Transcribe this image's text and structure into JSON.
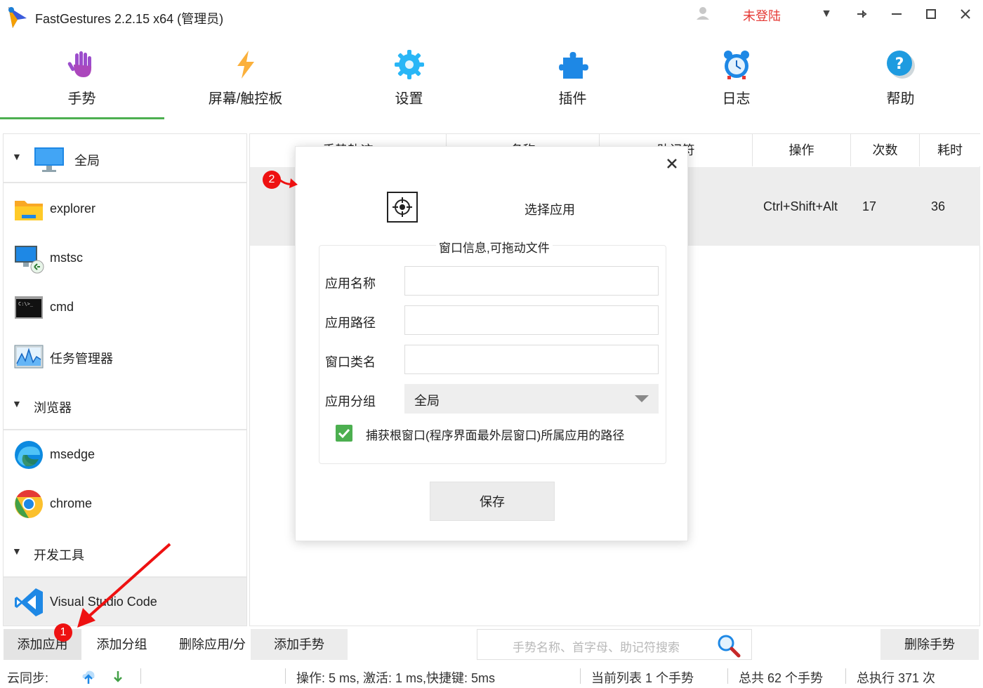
{
  "window": {
    "title": "FastGestures 2.2.15 x64 (管理员)",
    "login_status": "未登陆",
    "login_color": "#e53935",
    "controls": [
      "dropdown-icon",
      "pin-icon",
      "minimize-icon",
      "maximize-icon",
      "close-icon"
    ]
  },
  "nav": {
    "items": [
      {
        "label": "手势",
        "icon": "hand-icon"
      },
      {
        "label": "屏幕/触控板",
        "icon": "lightning-icon"
      },
      {
        "label": "设置",
        "icon": "gear-icon"
      },
      {
        "label": "插件",
        "icon": "puzzle-icon"
      },
      {
        "label": "日志",
        "icon": "alarm-clock-icon"
      },
      {
        "label": "帮助",
        "icon": "help-icon"
      }
    ],
    "active": "手势",
    "accent_color": "#4caf50"
  },
  "sidebar": {
    "items": [
      {
        "label": "全局",
        "type": "group"
      },
      {
        "label": "explorer",
        "type": "app"
      },
      {
        "label": "mstsc",
        "type": "app"
      },
      {
        "label": "cmd",
        "type": "app"
      },
      {
        "label": "任务管理器",
        "type": "app"
      },
      {
        "label": "浏览器",
        "type": "group"
      },
      {
        "label": "msedge",
        "type": "app"
      },
      {
        "label": "chrome",
        "type": "app"
      },
      {
        "label": "开发工具",
        "type": "group"
      },
      {
        "label": "Visual Studio Code",
        "type": "app",
        "selected": true
      }
    ],
    "buttons": {
      "add_app": "添加应用",
      "add_group": "添加分组",
      "delete": "删除应用/分"
    }
  },
  "table": {
    "headers": [
      "手势轨迹",
      "名称",
      "助记符",
      "操作",
      "次数",
      "耗时"
    ],
    "rows": [
      {
        "shortcut": "Ctrl+Shift+Alt",
        "count": "17",
        "time": "36"
      }
    ]
  },
  "dialog": {
    "title": "选择应用",
    "legend": "窗口信息,可拖动文件",
    "fields": {
      "app_name_label": "应用名称",
      "app_name_value": "",
      "app_path_label": "应用路径",
      "app_path_value": "",
      "window_class_label": "窗口类名",
      "window_class_value": "",
      "group_label": "应用分组",
      "group_value": "全局"
    },
    "checkbox": {
      "checked": true,
      "label": "捕获根窗口(程序界面最外层窗口)所属应用的路径"
    },
    "save_label": "保存"
  },
  "actions": {
    "add_gesture": "添加手势",
    "search_placeholder": "手势名称、首字母、助记符搜索",
    "delete_gesture": "删除手势"
  },
  "status": {
    "sync_label": "云同步:",
    "perf": "操作: 5 ms, 激活: 1 ms,快捷键: 5ms",
    "current_list": "当前列表 1 个手势",
    "total": "总共 62 个手势",
    "executed": "总执行 371 次"
  },
  "annotations": {
    "badge1": "1",
    "badge2": "2",
    "color": "#e11111"
  }
}
